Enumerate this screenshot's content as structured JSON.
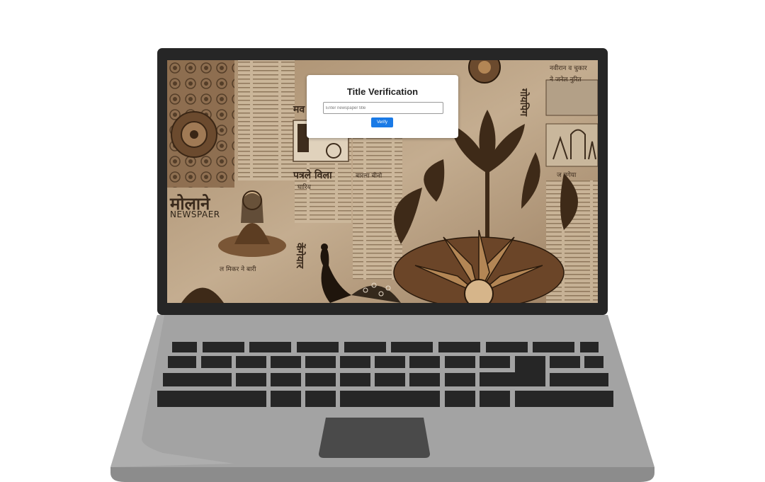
{
  "dialog": {
    "title": "Title Verification",
    "input_placeholder": "Enter newspaper title",
    "input_value": "",
    "verify_label": "Verify"
  },
  "wallpaper": {
    "masthead_devanagari": "मोलाने",
    "masthead_latin": "NEWSPAER",
    "headline_devanagari": "पत्रले विला",
    "sub_devanagari": "घारिय",
    "top_right": "नवीरान व चुकार",
    "top_right_2": "ने जनेल नुरित",
    "right_column": "गोयपिग",
    "caption_right": "ज बगेया",
    "caption_mid": "बारला बीनो",
    "lower_left": "ल मिकर ने बारी",
    "peacock_text": "केंगेयार",
    "small_left": "मव"
  },
  "colors": {
    "bezel": "#262626",
    "body": "#a3a3a3",
    "keys": "#262626",
    "trackpad": "#4a4a4a",
    "button": "#1a7ae6",
    "sepia": "#b59b7c"
  }
}
